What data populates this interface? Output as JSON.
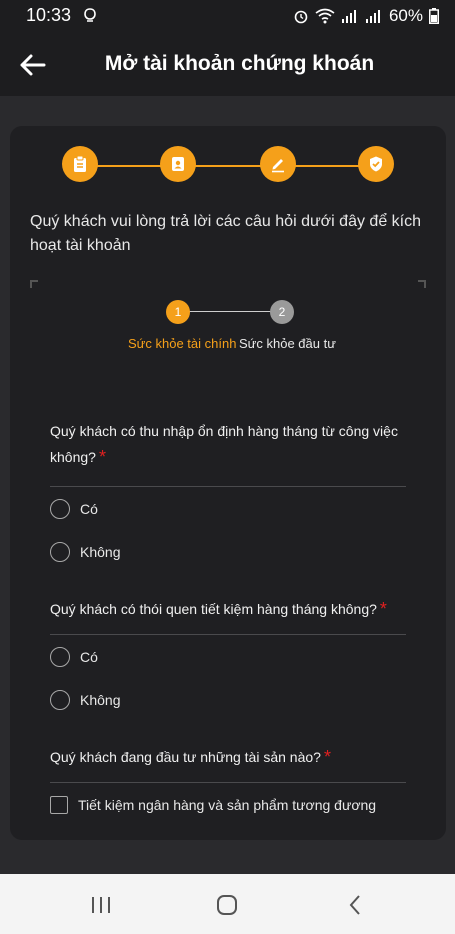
{
  "status_bar": {
    "time": "10:33",
    "battery": "60%"
  },
  "header": {
    "title": "Mở tài khoản chứng khoán"
  },
  "steps": [
    {
      "icon": "clipboard-icon"
    },
    {
      "icon": "id-card-icon"
    },
    {
      "icon": "pencil-icon"
    },
    {
      "icon": "shield-check-icon"
    }
  ],
  "intro": "Quý khách vui lòng trả lời các câu hỏi dưới đây để kích hoạt tài khoản",
  "substeps": [
    {
      "number": "1",
      "label": "Sức khỏe tài chính"
    },
    {
      "number": "2",
      "label": "Sức khỏe đầu tư"
    }
  ],
  "questions": [
    {
      "text": "Quý khách có thu nhập ổn định hàng tháng từ công việc không?",
      "required": "*",
      "options": [
        "Có",
        "Không"
      ]
    },
    {
      "text": "Quý khách có thói quen tiết kiệm hàng tháng không?",
      "required": "*",
      "options": [
        "Có",
        "Không"
      ]
    },
    {
      "text": "Quý khách đang đầu tư những tài sản nào?",
      "required": "*",
      "options": [
        "Tiết kiệm ngân hàng và sản phẩm tương đương"
      ]
    }
  ],
  "colors": {
    "accent": "#f5a01a",
    "background": "#2a2a2d",
    "card": "#1f1f22",
    "required": "#e02020"
  }
}
